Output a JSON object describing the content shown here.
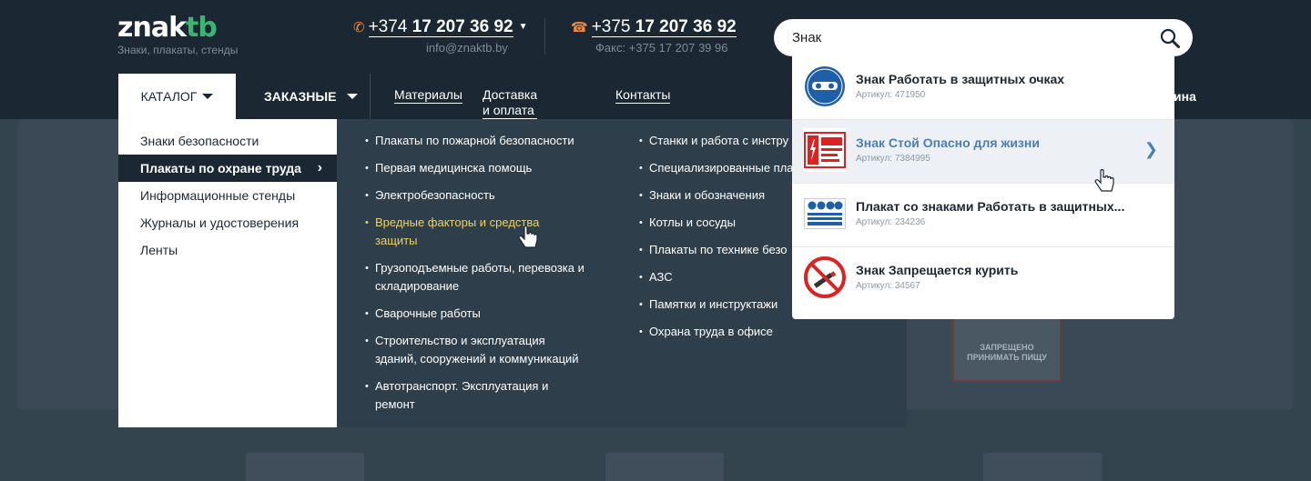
{
  "logo": {
    "mark_left": "znak",
    "mark_right": "tb",
    "tagline": "Знаки, плакаты, стенды"
  },
  "phones": {
    "primary": {
      "code": "+374",
      "number": "17 207 36 92",
      "email": "info@znaktb.by"
    },
    "secondary": {
      "code": "+375",
      "number": "17 207 36 92",
      "fax": "Факс: +375 17 207 39 96"
    }
  },
  "search": {
    "value": "Знак",
    "placeholder": ""
  },
  "nav": {
    "catalog": "КАТАЛОГ",
    "custom": "ЗАКАЗНЫЕ",
    "links": [
      "Материалы",
      "Доставка и оплата",
      "Контакты"
    ],
    "cart_tail": "ина"
  },
  "catalog_menu": {
    "categories": [
      "Знаки безопасности",
      "Плакаты по охране труда",
      "Информационные стенды",
      "Журналы и удостоверения",
      "Ленты"
    ],
    "col1": [
      "Плакаты по пожарной безопасности",
      "Первая медицинска помощь",
      "Электробезопасность",
      "Вредные факторы и средства защиты",
      "Грузоподъемные работы, перевозка и складирование",
      "Сварочные работы",
      "Строительство и эксплуатация зданий, сооружений и коммуникаций",
      "Автотранспорт. Эксплуатация и ремонт"
    ],
    "col2": [
      "Станки и работа с инстру",
      "Специализированные пла",
      "Знаки и обозначения",
      "Котлы и сосуды",
      "Плакаты по технике безо",
      "АЗС",
      "Памятки и инструктажи",
      "Охрана труда в офисе"
    ]
  },
  "results": [
    {
      "title": "Знак Работать в защитных очках",
      "sku": "Артикул: 471950",
      "icon": "goggles-sign-icon"
    },
    {
      "title": "Знак Стой Опасно для жизни",
      "sku": "Артикул: 7384995",
      "icon": "stop-danger-sign-icon"
    },
    {
      "title": "Плакат со знаками Работать в защитных...",
      "sku": "Артикул: 234236",
      "icon": "protective-poster-icon"
    },
    {
      "title": "Знак Запрещается курить",
      "sku": "Артикул: 34567",
      "icon": "no-smoking-sign-icon"
    }
  ],
  "background": {
    "sign_text_1": "ЗАПРЕЩЕНО",
    "sign_text_2": "ПРИНИМАТЬ ПИЩУ"
  },
  "colors": {
    "header_bg": "#1b2833",
    "accent_green": "#3cb371",
    "phone_icon": "#f28a3d",
    "highlight": "#e7d36a",
    "link_active": "#4a7fb5"
  }
}
